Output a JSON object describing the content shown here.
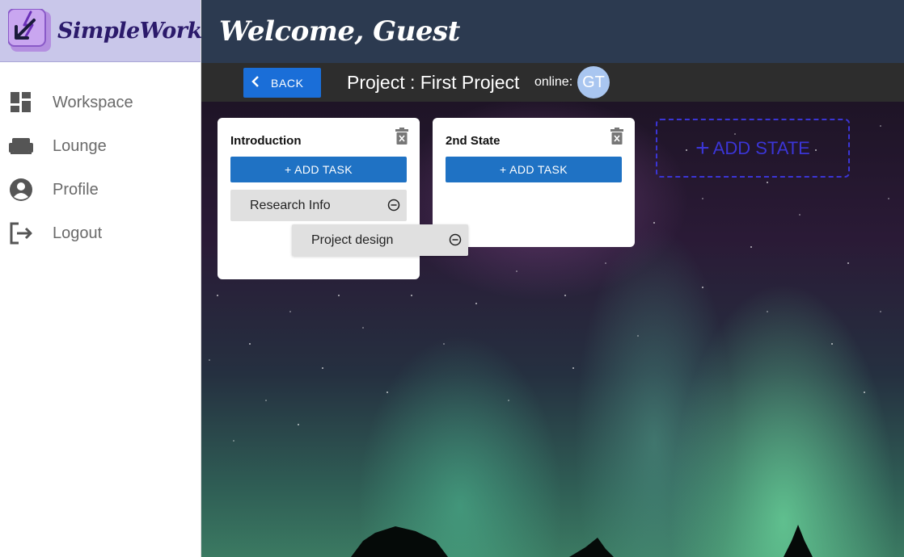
{
  "app": {
    "name": "SimpleWork"
  },
  "sidebar": {
    "items": [
      {
        "label": "Workspace",
        "icon": "dashboard-icon"
      },
      {
        "label": "Lounge",
        "icon": "sofa-icon"
      },
      {
        "label": "Profile",
        "icon": "account-circle-icon"
      },
      {
        "label": "Logout",
        "icon": "logout-icon"
      }
    ]
  },
  "header": {
    "welcome": "Welcome, Guest"
  },
  "subbar": {
    "back_label": "BACK",
    "project_title": "Project : First Project",
    "online_label": "online:",
    "online_users": [
      "GT"
    ]
  },
  "board": {
    "states": [
      {
        "title": "Introduction",
        "add_task_label": "+ ADD TASK",
        "tasks": [
          {
            "label": "Research Info"
          },
          {
            "label": "Project design"
          }
        ]
      },
      {
        "title": "2nd State",
        "add_task_label": "+ ADD TASK",
        "tasks": []
      }
    ],
    "add_state_label": "ADD STATE",
    "add_state_icon": "+"
  },
  "colors": {
    "header_bg": "#2c3a50",
    "brand_bg": "#c9c7ea",
    "primary_button": "#1f72c4",
    "add_state_accent": "#3b35d6"
  }
}
